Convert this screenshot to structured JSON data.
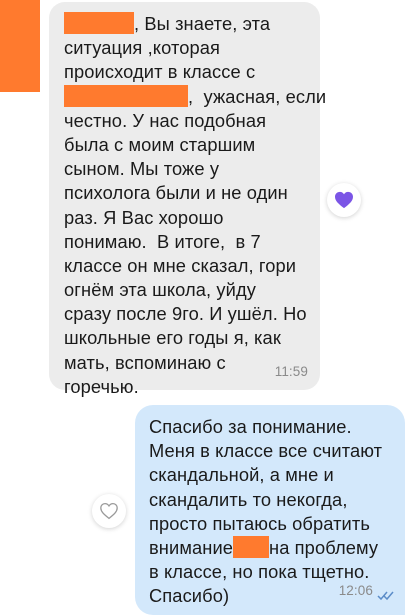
{
  "incoming_message": {
    "lines": [
      ", Вы знаете, эта",
      "ситуация ,которая",
      "происходит в классе с",
      ",  ужасная, если",
      "честно. У нас подобная",
      "была с моим старшим",
      "сыном. Мы тоже у",
      "психолога были и не один",
      "раз. Я Вас хорошо",
      "понимаю.  В итоге,  в 7",
      "классе он мне сказал, гори",
      "огнём эта школа, уйду",
      "сразу после 9го. И ушёл. Но",
      "школьные его годы я, как",
      "мать, вспоминаю с",
      "горечью."
    ],
    "time": "11:59",
    "reaction": "heart"
  },
  "outgoing_message": {
    "lines": [
      "Спасибо за понимание.",
      "Меня в классе все считают",
      "скандальной, а мне и",
      "скандалить то некогда,",
      "просто пытаюсь обратить",
      "внимание",
      "на проблему",
      "в классе, но пока тщетно.",
      "Спасибо)"
    ],
    "time": "12:06",
    "status": "read",
    "reaction_button": "heart-outline"
  },
  "colors": {
    "incoming_bubble": "#ececec",
    "outgoing_bubble": "#d3e8fb",
    "redaction": "#ff7a2e",
    "heart": "#7b55e6",
    "read_ticks": "#5b8cc8",
    "time_text": "#8a8a8a"
  }
}
